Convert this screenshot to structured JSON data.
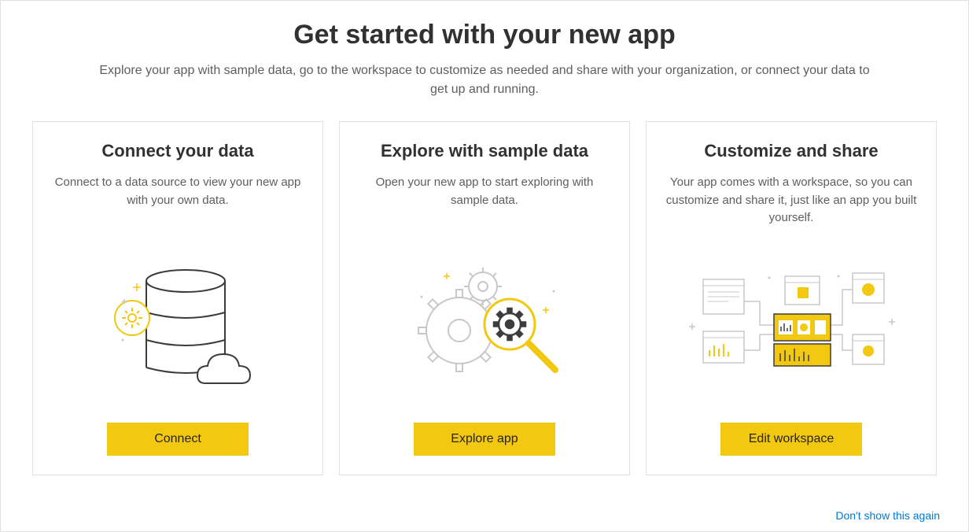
{
  "header": {
    "title": "Get started with your new app",
    "subtitle": "Explore your app with sample data, go to the workspace to customize as needed and share with your organization, or connect your data to get up and running."
  },
  "cards": [
    {
      "title": "Connect your data",
      "description": "Connect to a data source to view your new app with your own data.",
      "button": "Connect"
    },
    {
      "title": "Explore with sample data",
      "description": "Open your new app to start exploring with sample data.",
      "button": "Explore app"
    },
    {
      "title": "Customize and share",
      "description": "Your app comes with a workspace, so you can customize and share it, just like an app you built yourself.",
      "button": "Edit workspace"
    }
  ],
  "footer": {
    "dismiss": "Don't show this again"
  }
}
